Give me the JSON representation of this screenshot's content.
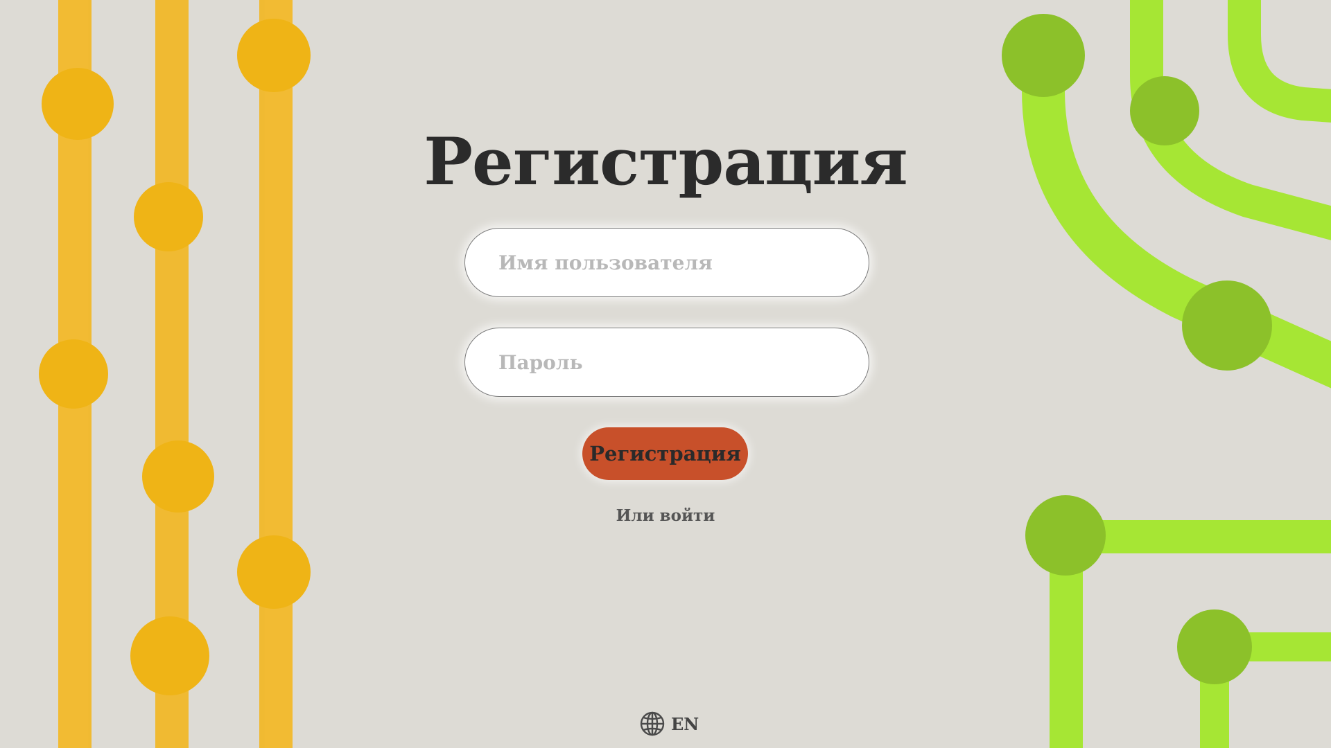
{
  "page": {
    "title": "Регистрация"
  },
  "form": {
    "username_placeholder": "Имя пользователя",
    "password_placeholder": "Пароль",
    "submit_label": "Регистрация",
    "login_link": "Или войти"
  },
  "language": {
    "icon": "globe-icon",
    "label": "EN"
  },
  "colors": {
    "background": "#dddbd5",
    "accent_button": "#c8502a",
    "decor_yellow": "#f2b92a",
    "decor_yellow_dot": "#efb416",
    "decor_green": "#a6e634",
    "decor_green_dot": "#8cc12a"
  }
}
